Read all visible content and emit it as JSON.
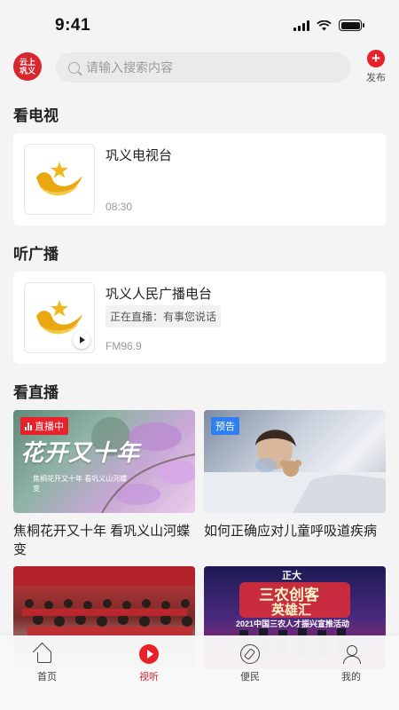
{
  "status_bar": {
    "time": "9:41"
  },
  "header": {
    "logo_line1": "云上",
    "logo_line2": "巩义",
    "search_placeholder": "请输入搜索内容",
    "publish_icon": "+",
    "publish_label": "发布"
  },
  "tv_section": {
    "title": "看电视",
    "channel_name": "巩义电视台",
    "time": "08:30"
  },
  "radio_section": {
    "title": "听广播",
    "station_name": "巩义人民广播电台",
    "now_playing": "正在直播：有事您说话",
    "frequency": "FM96.9"
  },
  "live_section": {
    "title": "看直播",
    "items": [
      {
        "badge": "直播中",
        "thumb_text": "花开又十年",
        "thumb_caption": "焦桐花开又十年 看巩义山河蝶变",
        "title": "焦桐花开又十年 看巩义山河蝶变"
      },
      {
        "badge": "预告",
        "title": "如何正确应对儿童呼吸道疾病"
      },
      {
        "title": ""
      },
      {
        "thumb_text_top": "正大",
        "thumb_text": "三农创客",
        "thumb_text_2": "英雄汇",
        "thumb_caption": "2021中国三农人才振兴宣推活动",
        "title": ""
      }
    ]
  },
  "tab_bar": {
    "tabs": [
      {
        "label": "首页",
        "icon": "home-icon"
      },
      {
        "label": "视听",
        "icon": "video-icon",
        "active": true
      },
      {
        "label": "便民",
        "icon": "compass-icon"
      },
      {
        "label": "我的",
        "icon": "user-icon"
      }
    ]
  },
  "colors": {
    "accent": "#e8212b",
    "preview": "#2d7ff2",
    "background": "#f4f4f4"
  }
}
